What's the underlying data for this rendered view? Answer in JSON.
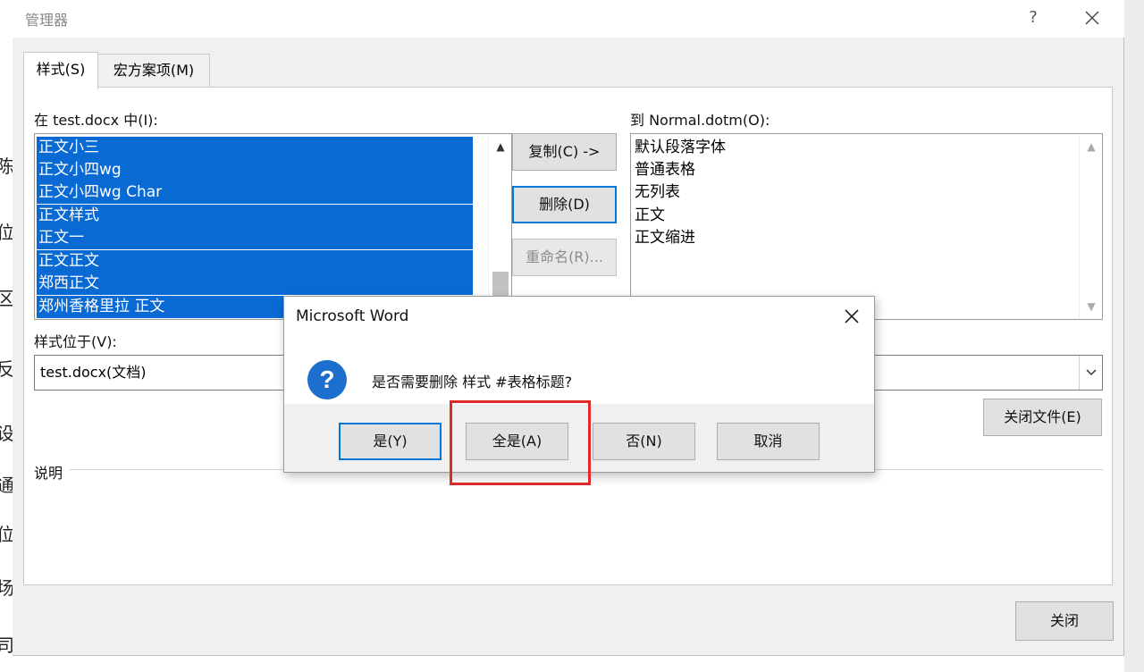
{
  "window": {
    "title": "管理器",
    "help": "?"
  },
  "tabs": [
    {
      "label": "样式(S)",
      "active": true
    },
    {
      "label": "宏方案项(M)",
      "active": false
    }
  ],
  "left": {
    "in_label": "在 test.docx 中(I):",
    "items": [
      "正文小三",
      "正文小四wg",
      "正文小四wg Char",
      "正文样式",
      "正文一",
      "正文正文",
      "郑西正文",
      "郑州香格里拉 正文"
    ],
    "location_label": "样式位于(V):",
    "location_value": "test.docx(文档)"
  },
  "right": {
    "to_label": "到 Normal.dotm(O):",
    "items": [
      "默认段落字体",
      "普通表格",
      "无列表",
      "正文",
      "正文缩进"
    ],
    "close_file_label": "关闭文件(E)"
  },
  "middle_buttons": {
    "copy": "复制(C) ->",
    "delete": "删除(D)",
    "rename": "重命名(R)..."
  },
  "description_label": "说明",
  "close_label": "关闭",
  "background_text": [
    "陈",
    "位",
    "区",
    "反",
    "设",
    "通",
    "位",
    "场",
    "司"
  ],
  "msgbox": {
    "title": "Microsoft Word",
    "icon": "question-icon",
    "icon_glyph": "?",
    "message": "是否需要删除 样式 #表格标题?",
    "buttons": {
      "yes": "是(Y)",
      "yes_all": "全是(A)",
      "no": "否(N)",
      "cancel": "取消"
    }
  },
  "colors": {
    "selection": "#0a6ad4",
    "focus_border": "#0078d7",
    "highlight_box": "#e02a2a"
  }
}
